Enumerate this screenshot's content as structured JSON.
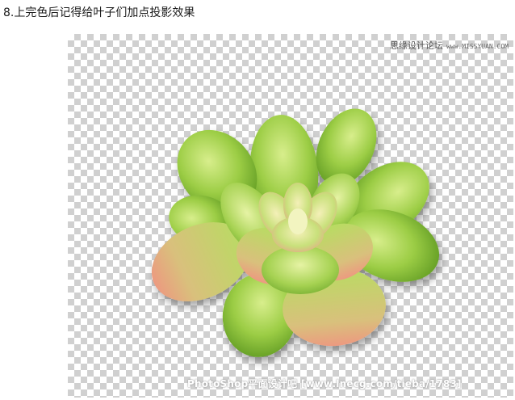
{
  "step": {
    "title": "8.上完色后记得给叶子们加点投影效果"
  },
  "watermark": {
    "site": "思缘设计论坛",
    "url": "www.MISSYUAN.COM",
    "bottom": "PhotoShop平面设计吧 [www.lnecg.com/tieba/1783]"
  },
  "colors": {
    "leaf_green": "#8fc43a",
    "leaf_light": "#d6ec8a",
    "leaf_tip_pink": "#e89a7a",
    "checker_gray": "#d0d0d0"
  }
}
